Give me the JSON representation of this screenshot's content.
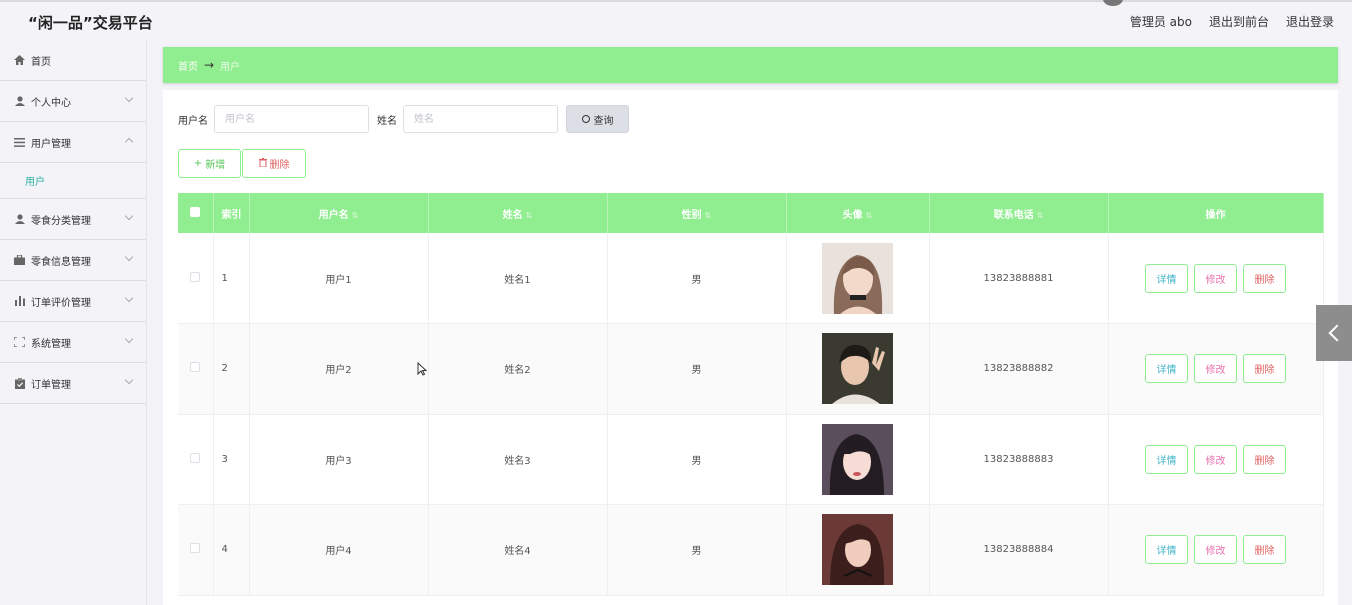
{
  "header": {
    "site_title": "“闲一品”交易平台",
    "admin_label": "管理员 abo",
    "back_frontend": "退出到前台",
    "logout": "退出登录"
  },
  "sidebar": {
    "items": [
      {
        "label": "首页",
        "icon": "home-icon"
      },
      {
        "label": "个人中心",
        "icon": "user-icon"
      },
      {
        "label": "用户管理",
        "icon": "list-icon",
        "expanded": true
      },
      {
        "label": "零食分类管理",
        "icon": "user-icon"
      },
      {
        "label": "零食信息管理",
        "icon": "briefcase-icon"
      },
      {
        "label": "订单评价管理",
        "icon": "bar-chart-icon"
      },
      {
        "label": "系统管理",
        "icon": "fullscreen-icon"
      },
      {
        "label": "订单管理",
        "icon": "clipboard-icon"
      }
    ],
    "submenu_active": "用户"
  },
  "breadcrumb": {
    "home": "首页",
    "arrow": "→",
    "current": "用户"
  },
  "search": {
    "username_label": "用户名",
    "username_placeholder": "用户名",
    "name_label": "姓名",
    "name_placeholder": "姓名",
    "query_button": "查询"
  },
  "actions": {
    "add": "新增",
    "delete": "删除"
  },
  "table": {
    "headers": [
      "索引",
      "用户名",
      "姓名",
      "性别",
      "头像",
      "联系电话",
      "操作"
    ],
    "rows": [
      {
        "index": "1",
        "username": "用户1",
        "name": "姓名1",
        "gender": "男",
        "phone": "13823888881"
      },
      {
        "index": "2",
        "username": "用户2",
        "name": "姓名2",
        "gender": "男",
        "phone": "13823888882"
      },
      {
        "index": "3",
        "username": "用户3",
        "name": "姓名3",
        "gender": "男",
        "phone": "13823888883"
      },
      {
        "index": "4",
        "username": "用户4",
        "name": "姓名4",
        "gender": "男",
        "phone": "13823888884"
      }
    ],
    "row_actions": {
      "detail": "详情",
      "edit": "修改",
      "remove": "删除"
    }
  },
  "colors": {
    "accent": "#90ee90",
    "submenu_active": "#2fb0a5",
    "danger": "#e06060"
  }
}
